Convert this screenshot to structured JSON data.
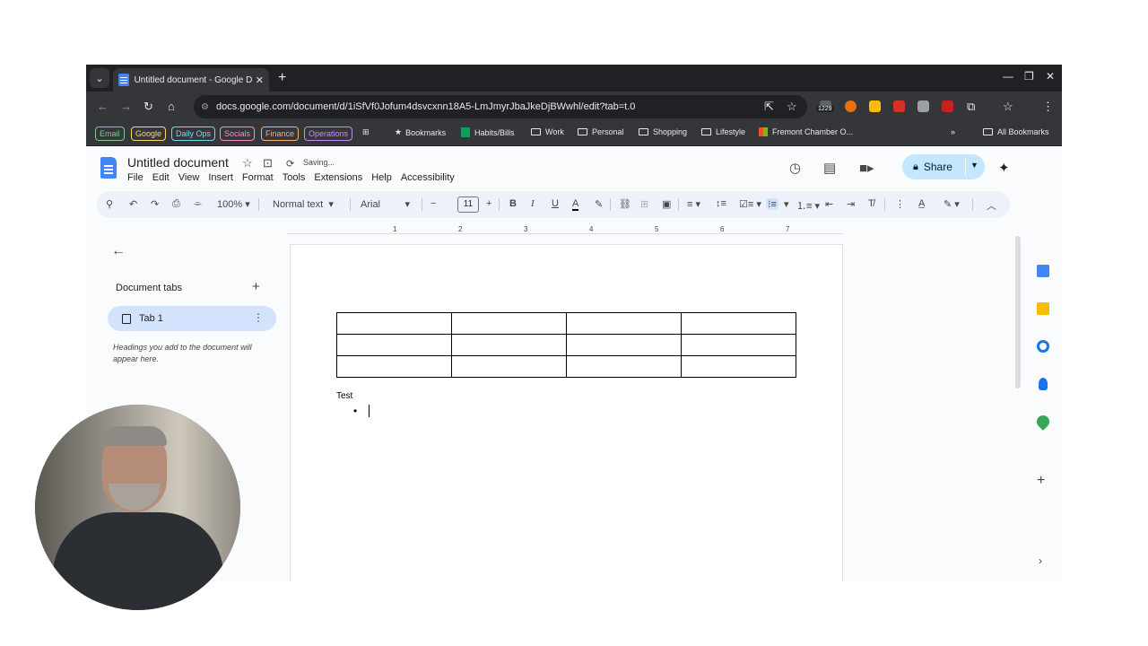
{
  "browser": {
    "tab_title": "Untitled document - Google Do",
    "url": "docs.google.com/document/d/1iSfVf0Jofum4dsvcxnn18A5-LmJmyrJbaJkeDjBWwhl/edit?tab=t.0",
    "extension_badge": "1229",
    "bookmarks": {
      "pills": [
        {
          "label": "Email",
          "color": "#81c995"
        },
        {
          "label": "Google",
          "color": "#fdd663"
        },
        {
          "label": "Daily Ops",
          "color": "#78d9ec"
        },
        {
          "label": "Socials",
          "color": "#ff8bcb"
        },
        {
          "label": "Finance",
          "color": "#fcad70"
        },
        {
          "label": "Operations",
          "color": "#c58af9"
        }
      ],
      "items": [
        "Bookmarks",
        "Habits/Bills",
        "Work",
        "Personal",
        "Shopping",
        "Lifestyle",
        "Fremont Chamber O..."
      ],
      "all_bookmarks": "All Bookmarks"
    }
  },
  "docs": {
    "title": "Untitled document",
    "save_status": "Saving...",
    "menu": [
      "File",
      "Edit",
      "View",
      "Insert",
      "Format",
      "Tools",
      "Extensions",
      "Help",
      "Accessibility"
    ],
    "share_label": "Share",
    "toolbar": {
      "zoom": "100%",
      "style": "Normal text",
      "font": "Arial",
      "font_size": "11"
    },
    "ruler_marks": [
      "1",
      "2",
      "3",
      "4",
      "5",
      "6",
      "7"
    ],
    "outline": {
      "heading": "Document tabs",
      "tab_name": "Tab 1",
      "hint": "Headings you add to the document will appear here."
    },
    "body": {
      "table_rows": 3,
      "table_cols": 4,
      "text": "Test"
    }
  },
  "colors": {
    "accent": "#4285f4",
    "share_bg": "#c2e7ff",
    "selected_tab": "#d3e3fd"
  }
}
